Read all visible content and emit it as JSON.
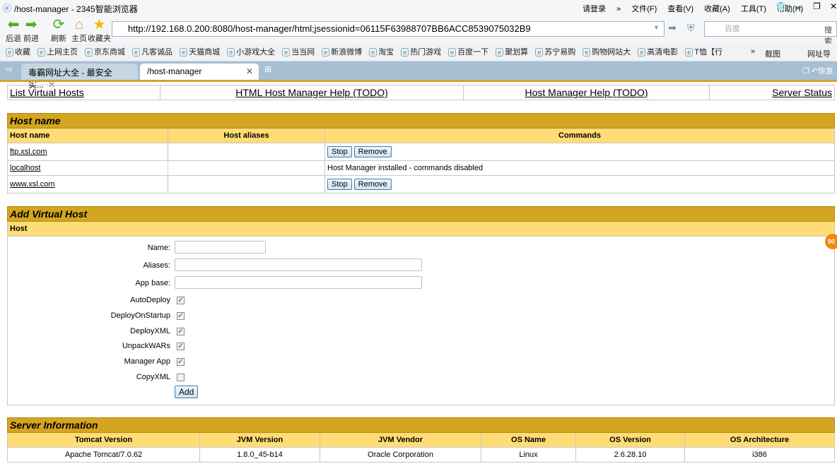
{
  "browser": {
    "window_title": "/host-manager - 2345智能浏览器",
    "menu": [
      "请登录",
      "»",
      "文件(F)",
      "查看(V)",
      "收藏(A)",
      "工具(T)",
      "帮助(H)"
    ],
    "nav": {
      "back": "后退",
      "forward": "前进",
      "refresh": "刷新",
      "home": "主页",
      "favorites": "收藏夹"
    },
    "url": "http://192.168.0.200:8080/host-manager/html;jsessionid=06115F63988707BB6ACC8539075032B9",
    "search_placeholder": "百度",
    "search_button": "搜索",
    "bookmarks": [
      "收藏",
      "上网主页",
      "京东商城",
      "凡客诚品",
      "天猫商城",
      "小游戏大全",
      "当当网",
      "新浪微博",
      "淘宝",
      "热门游戏",
      "百度一下",
      "聚划算",
      "苏宁易购",
      "购物网站大",
      "高清电影",
      "T恤【行"
    ],
    "bookmarks_right": [
      "截图",
      "网址导"
    ],
    "tabs": [
      {
        "label": "毒霸网址大全 - 最安全实...",
        "active": false
      },
      {
        "label": "/host-manager",
        "active": true
      }
    ],
    "restore_label": "恢复"
  },
  "links": [
    "List Virtual Hosts",
    "HTML Host Manager Help (TODO)",
    "Host Manager Help (TODO)",
    "Server Status"
  ],
  "host_table": {
    "title": "Host name",
    "columns": [
      "Host name",
      "Host aliases",
      "Commands"
    ],
    "rows": [
      {
        "name": "ftp.xsl.com",
        "aliases": "",
        "commands": [
          "Stop",
          "Remove"
        ]
      },
      {
        "name": "localhost",
        "aliases": "",
        "note": "Host Manager installed - commands disabled"
      },
      {
        "name": "www.xsl.com",
        "aliases": "",
        "commands": [
          "Stop",
          "Remove"
        ]
      }
    ]
  },
  "add_host": {
    "title": "Add Virtual Host",
    "subtitle": "Host",
    "fields": [
      {
        "label": "Name:",
        "value": ""
      },
      {
        "label": "Aliases:",
        "value": ""
      },
      {
        "label": "App base:",
        "value": ""
      }
    ],
    "checkboxes": [
      {
        "label": "AutoDeploy",
        "checked": true
      },
      {
        "label": "DeployOnStartup",
        "checked": true
      },
      {
        "label": "DeployXML",
        "checked": true
      },
      {
        "label": "UnpackWARs",
        "checked": true
      },
      {
        "label": "Manager App",
        "checked": true
      },
      {
        "label": "CopyXML",
        "checked": false
      }
    ],
    "submit": "Add"
  },
  "server_info": {
    "title": "Server Information",
    "columns": [
      "Tomcat Version",
      "JVM Version",
      "JVM Vendor",
      "OS Name",
      "OS Version",
      "OS Architecture"
    ],
    "values": [
      "Apache Tomcat/7.0.62",
      "1.8.0_45-b14",
      "Oracle Corporation",
      "Linux",
      "2.6.28.10",
      "i386"
    ]
  },
  "badge": "90"
}
